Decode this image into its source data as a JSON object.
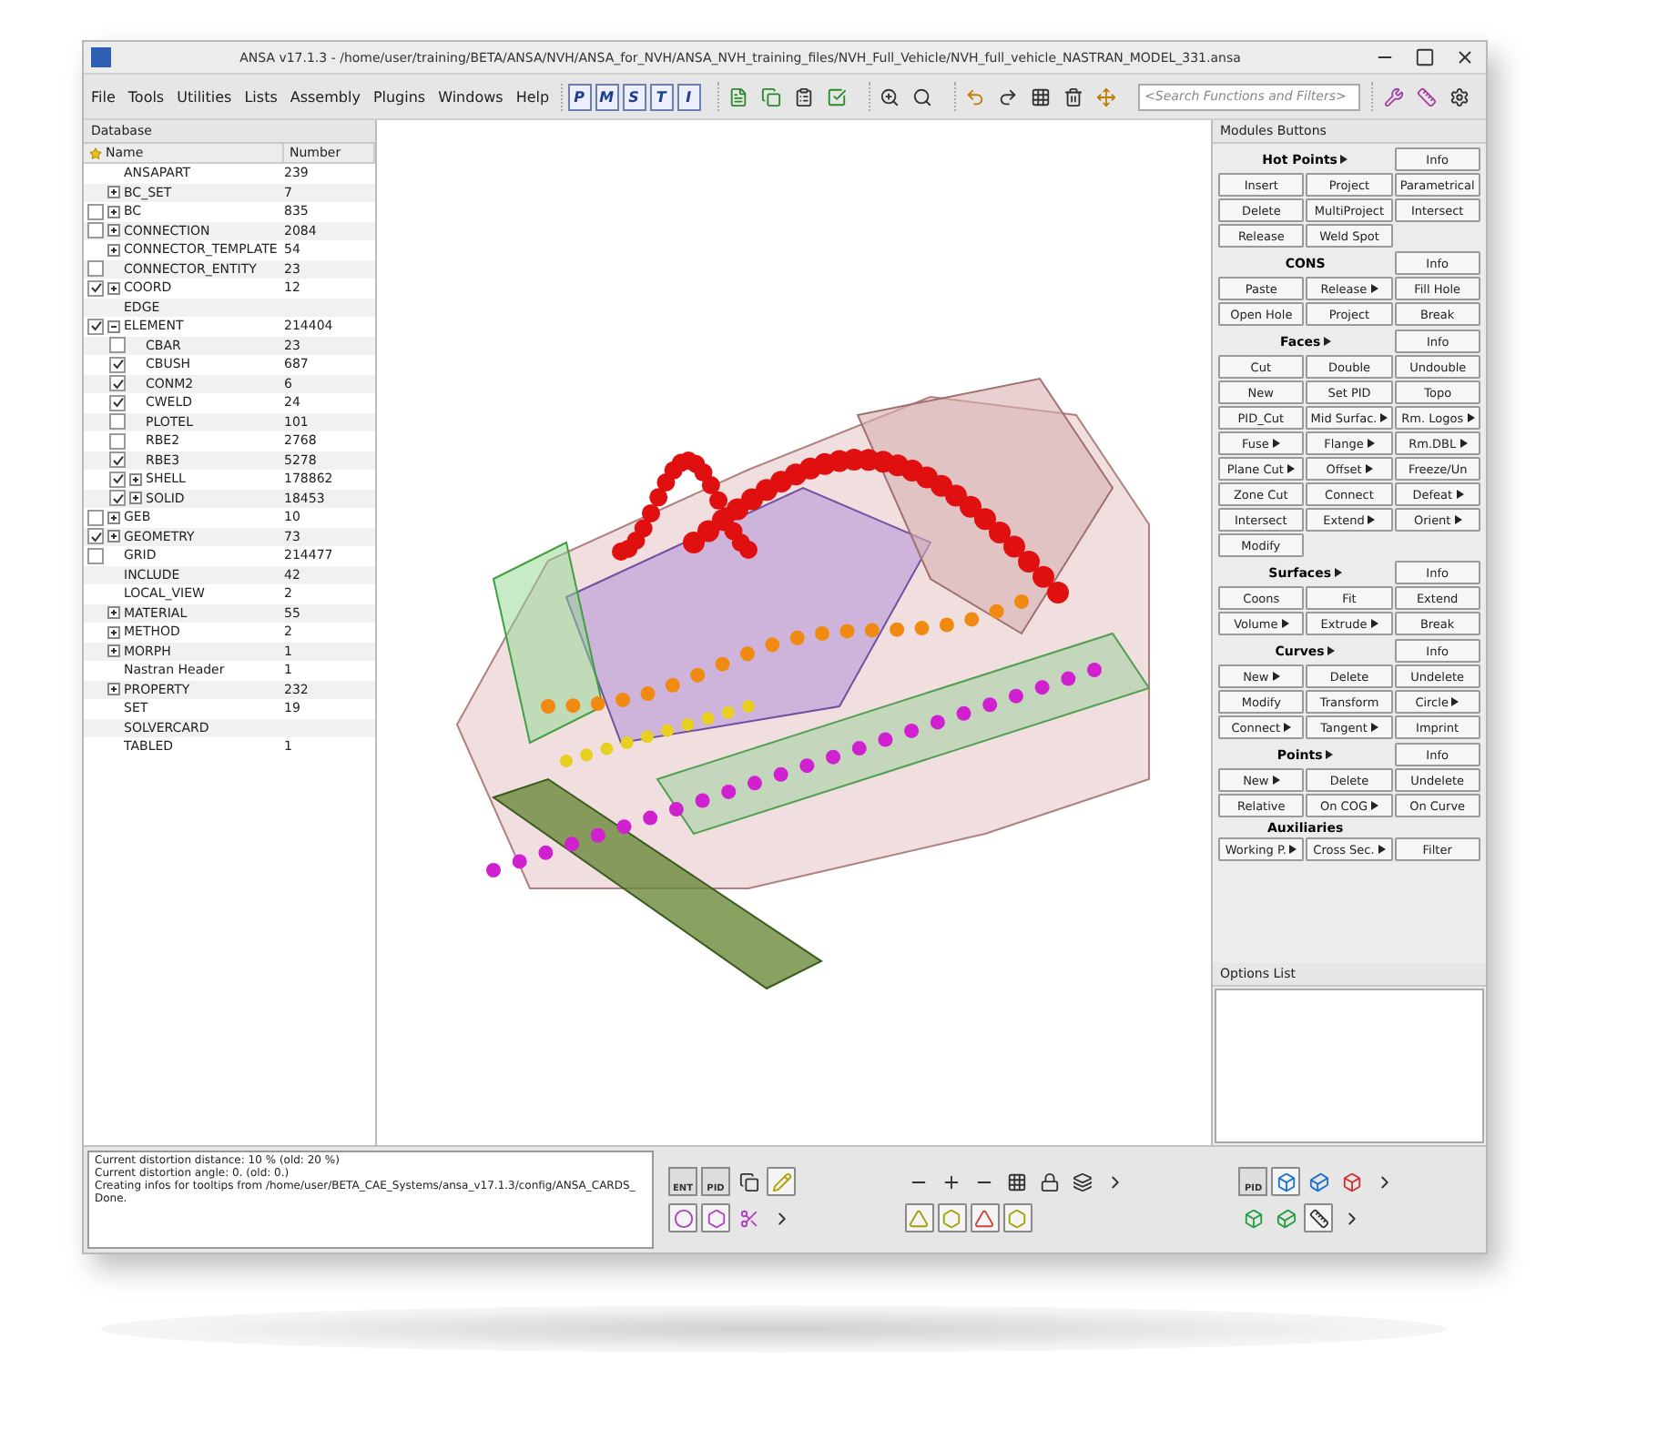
{
  "window": {
    "title": "ANSA v17.1.3 - /home/user/training/BETA/ANSA/NVH/ANSA_for_NVH/ANSA_NVH_training_files/NVH_Full_Vehicle/NVH_full_vehicle_NASTRAN_MODEL_331.ansa"
  },
  "menu": [
    "File",
    "Tools",
    "Utilities",
    "Lists",
    "Assembly",
    "Plugins",
    "Windows",
    "Help"
  ],
  "view_buttons": [
    "P",
    "M",
    "S",
    "T",
    "I"
  ],
  "search": {
    "placeholder": "<Search Functions and Filters>"
  },
  "tree": {
    "title": "Database",
    "columns": [
      "Name",
      "Number"
    ],
    "rows": [
      {
        "name": "ANSAPART",
        "number": "239"
      },
      {
        "name": "BC_SET",
        "number": "7",
        "expanded": false
      },
      {
        "name": "BC",
        "number": "835",
        "checked": false,
        "expanded": false
      },
      {
        "name": "CONNECTION",
        "number": "2084",
        "checked": false,
        "expanded": false
      },
      {
        "name": "CONNECTOR_TEMPLATE",
        "number": "54",
        "expanded": false
      },
      {
        "name": "CONNECTOR_ENTITY",
        "number": "23",
        "checked": false
      },
      {
        "name": "COORD",
        "number": "12",
        "checked": true,
        "expanded": false
      },
      {
        "name": "EDGE"
      },
      {
        "name": "ELEMENT",
        "number": "214404",
        "checked": true,
        "expanded": true,
        "children": [
          {
            "name": "CBAR",
            "number": "23",
            "checked": false
          },
          {
            "name": "CBUSH",
            "number": "687",
            "checked": true
          },
          {
            "name": "CONM2",
            "number": "6",
            "checked": true
          },
          {
            "name": "CWELD",
            "number": "24",
            "checked": true
          },
          {
            "name": "PLOTEL",
            "number": "101",
            "checked": false
          },
          {
            "name": "RBE2",
            "number": "2768",
            "checked": false
          },
          {
            "name": "RBE3",
            "number": "5278",
            "checked": true
          },
          {
            "name": "SHELL",
            "number": "178862",
            "checked": true,
            "expanded": false
          },
          {
            "name": "SOLID",
            "number": "18453",
            "checked": true,
            "expanded": false
          }
        ]
      },
      {
        "name": "GEB",
        "number": "10",
        "checked": false,
        "expanded": false
      },
      {
        "name": "GEOMETRY",
        "number": "73",
        "checked": true,
        "expanded": false
      },
      {
        "name": "GRID",
        "number": "214477",
        "checked": false
      },
      {
        "name": "INCLUDE",
        "number": "42"
      },
      {
        "name": "LOCAL_VIEW",
        "number": "2"
      },
      {
        "name": "MATERIAL",
        "number": "55",
        "expanded": false
      },
      {
        "name": "METHOD",
        "number": "2",
        "expanded": false
      },
      {
        "name": "MORPH",
        "number": "1",
        "expanded": false
      },
      {
        "name": "Nastran Header",
        "number": "1"
      },
      {
        "name": "PROPERTY",
        "number": "232",
        "expanded": false
      },
      {
        "name": "SET",
        "number": "19"
      },
      {
        "name": "SOLVERCARD"
      },
      {
        "name": "TABLED",
        "number": "1"
      }
    ]
  },
  "modules": {
    "title": "Modules Buttons",
    "sections": [
      {
        "title": "Hot Points",
        "menu": true,
        "info": "Info",
        "buttons": [
          {
            "label": "Insert"
          },
          {
            "label": "Project"
          },
          {
            "label": "Parametrical"
          },
          {
            "label": "Delete"
          },
          {
            "label": "MultiProject"
          },
          {
            "label": "Intersect"
          },
          {
            "label": "Release"
          },
          {
            "label": "Weld Spot"
          }
        ]
      },
      {
        "title": "CONS",
        "menu": false,
        "info": "Info",
        "buttons": [
          {
            "label": "Paste"
          },
          {
            "label": "Release",
            "menu": true
          },
          {
            "label": "Fill Hole"
          },
          {
            "label": "Open Hole"
          },
          {
            "label": "Project"
          },
          {
            "label": "Break"
          }
        ]
      },
      {
        "title": "Faces",
        "menu": true,
        "info": "Info",
        "buttons": [
          {
            "label": "Cut"
          },
          {
            "label": "Double"
          },
          {
            "label": "Undouble"
          },
          {
            "label": "New"
          },
          {
            "label": "Set PID"
          },
          {
            "label": "Topo"
          },
          {
            "label": "PID_Cut"
          },
          {
            "label": "Mid Surfac.",
            "menu": true
          },
          {
            "label": "Rm. Logos",
            "menu": true
          },
          {
            "label": "Fuse",
            "menu": true
          },
          {
            "label": "Flange",
            "menu": true
          },
          {
            "label": "Rm.DBL",
            "menu": true
          },
          {
            "label": "Plane Cut",
            "menu": true
          },
          {
            "label": "Offset",
            "menu": true
          },
          {
            "label": "Freeze/Un"
          },
          {
            "label": "Zone Cut"
          },
          {
            "label": "Connect"
          },
          {
            "label": "Defeat",
            "menu": true
          },
          {
            "label": "Intersect"
          },
          {
            "label": "Extend",
            "menu": true
          },
          {
            "label": "Orient",
            "menu": true
          },
          {
            "label": "Modify"
          }
        ]
      },
      {
        "title": "Surfaces",
        "menu": true,
        "info": "Info",
        "buttons": [
          {
            "label": "Coons"
          },
          {
            "label": "Fit"
          },
          {
            "label": "Extend"
          },
          {
            "label": "Volume",
            "menu": true
          },
          {
            "label": "Extrude",
            "menu": true
          },
          {
            "label": "Break"
          }
        ]
      },
      {
        "title": "Curves",
        "menu": true,
        "info": "Info",
        "buttons": [
          {
            "label": "New",
            "menu": true
          },
          {
            "label": "Delete"
          },
          {
            "label": "Undelete"
          },
          {
            "label": "Modify"
          },
          {
            "label": "Transform"
          },
          {
            "label": "Circle",
            "menu": true
          },
          {
            "label": "Connect",
            "menu": true
          },
          {
            "label": "Tangent",
            "menu": true
          },
          {
            "label": "Imprint"
          }
        ]
      },
      {
        "title": "Points",
        "menu": true,
        "info": "Info",
        "buttons": [
          {
            "label": "New",
            "menu": true
          },
          {
            "label": "Delete"
          },
          {
            "label": "Undelete"
          },
          {
            "label": "Relative"
          },
          {
            "label": "On COG",
            "menu": true
          },
          {
            "label": "On Curve"
          }
        ]
      },
      {
        "title": "Auxiliaries",
        "menu": false,
        "buttons": [
          {
            "label": "Working P.",
            "menu": true
          },
          {
            "label": "Cross Sec.",
            "menu": true
          },
          {
            "label": "Filter"
          }
        ]
      }
    ]
  },
  "options_list": {
    "title": "Options List"
  },
  "console": [
    "Current distortion distance: 10 % (old: 20 %)",
    "Current distortion angle: 0. (old: 0.)",
    "Creating infos for tooltips from /home/user/BETA_CAE_Systems/ansa_v17.1.3/config/ANSA_CARDS_",
    "Done."
  ],
  "bottom_toolbar": {
    "labels": [
      "ENT",
      "PID",
      "PID"
    ]
  }
}
